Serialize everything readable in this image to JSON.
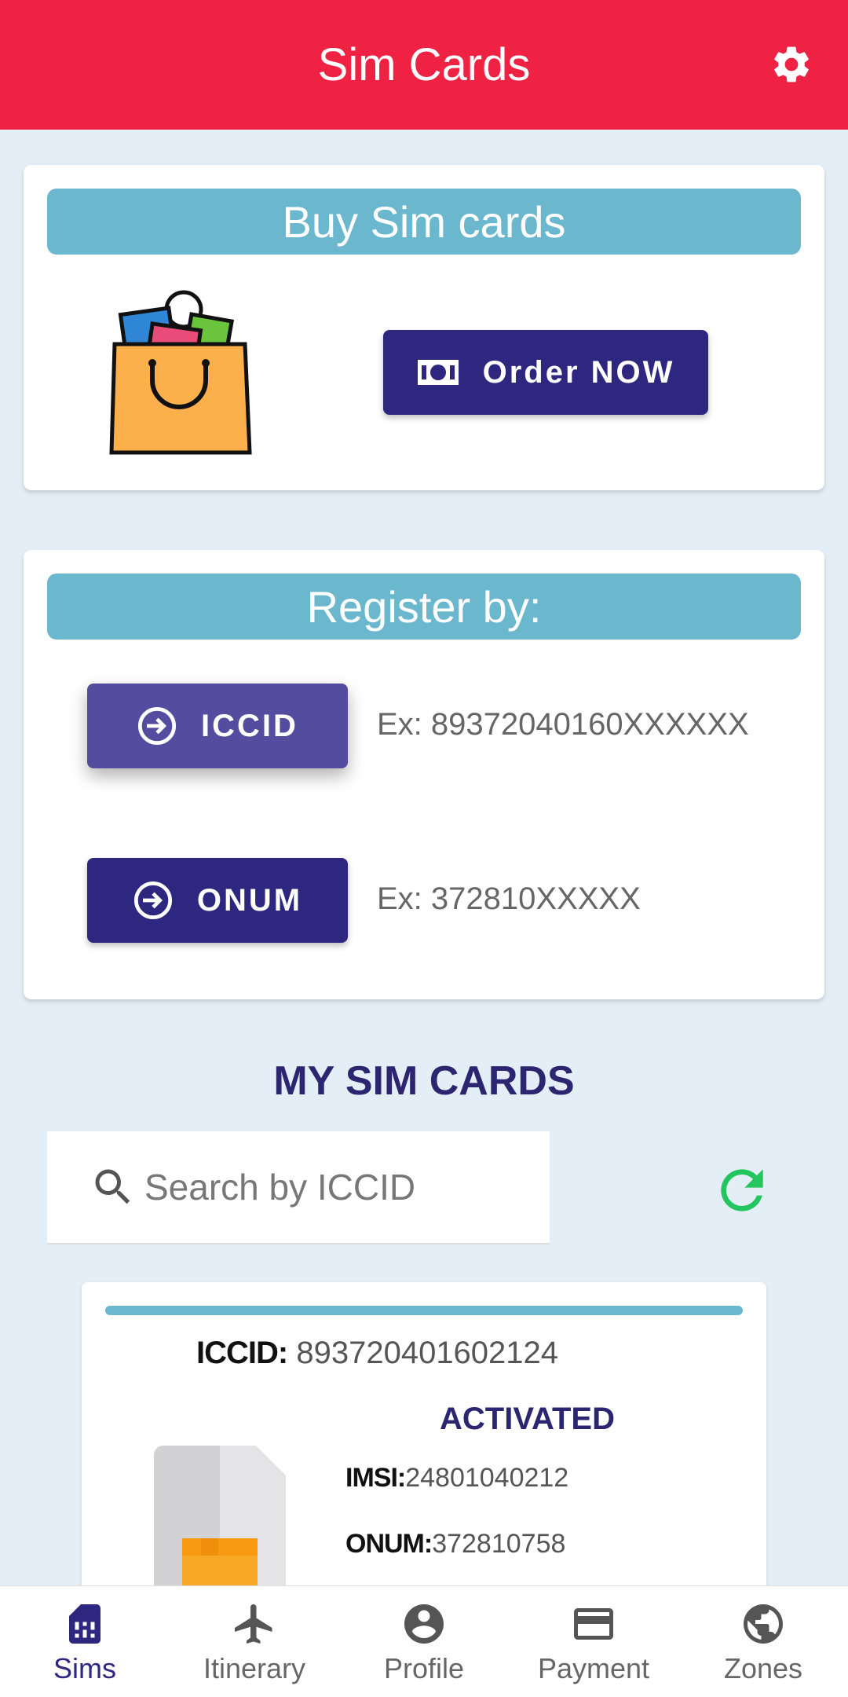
{
  "appbar": {
    "title": "Sim Cards"
  },
  "buy_card": {
    "header": "Buy Sim cards",
    "order_button": "Order NOW"
  },
  "register_card": {
    "header": "Register by:",
    "iccid_button": "ICCID",
    "iccid_hint": "Ex: 89372040160XXXXXX",
    "onum_button": "ONUM",
    "onum_hint": "Ex: 372810XXXXX"
  },
  "my_sims": {
    "title": "MY SIM CARDS",
    "search_placeholder": "Search by ICCID"
  },
  "sim": {
    "iccid_label": "ICCID:",
    "iccid_value": "893720401602124",
    "status": "ACTIVATED",
    "imsi_label": "IMSI:",
    "imsi_value": "24801040212",
    "onum_label": "ONUM:",
    "onum_value": "372810758"
  },
  "nav": {
    "items": [
      {
        "label": "Sims",
        "icon": "sim-card-icon"
      },
      {
        "label": "Itinerary",
        "icon": "airplane-icon"
      },
      {
        "label": "Profile",
        "icon": "account-circle-icon"
      },
      {
        "label": "Payment",
        "icon": "credit-card-icon"
      },
      {
        "label": "Zones",
        "icon": "globe-icon"
      }
    ],
    "active": "Sims"
  },
  "colors": {
    "appbar": "#ef2244",
    "header_bar": "#6bb7cd",
    "primary": "#2e2780",
    "refresh": "#22c55e",
    "background": "#e3eef6"
  }
}
